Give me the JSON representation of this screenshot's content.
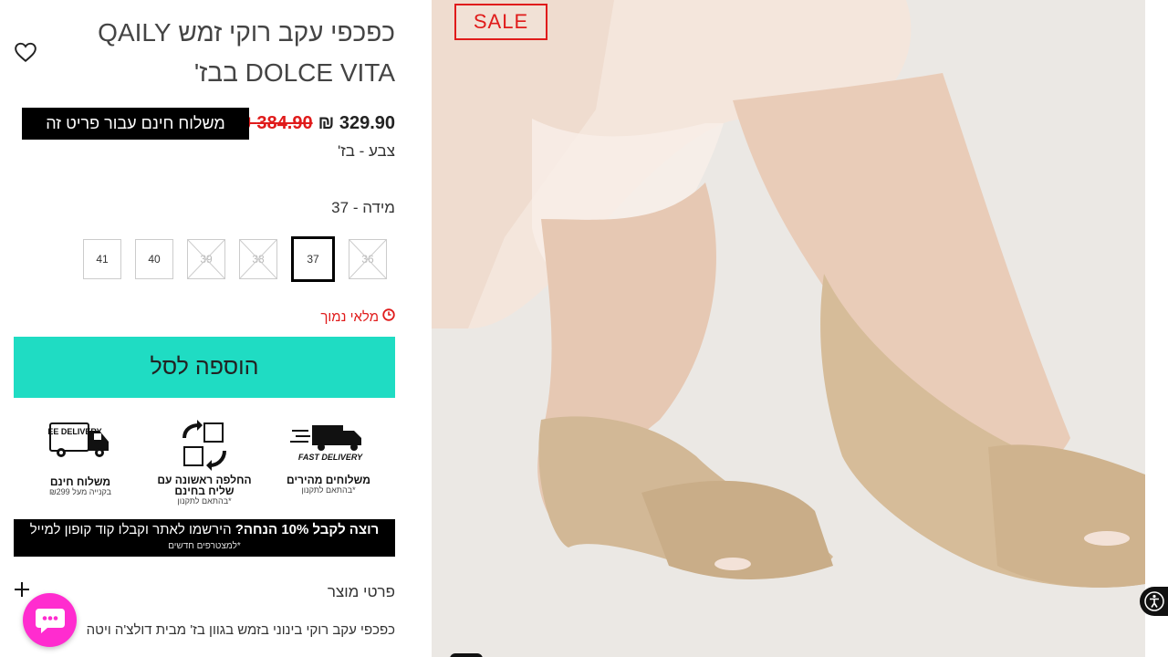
{
  "product": {
    "title": "כפכפי עקב רוקי זמש QAILY DOLCE VITA בבז'",
    "price_now": "329.90 ₪",
    "price_old": "384.90 ₪",
    "free_shipping_banner": "משלוח חינם עבור פריט זה",
    "color_label": "צבע - בז'",
    "size_label": "מידה - 37",
    "sale_badge": "SALE",
    "stock_status": "מלאי נמוך",
    "add_to_cart": "הוספה לסל"
  },
  "sizes": [
    {
      "label": "36",
      "available": false,
      "selected": false
    },
    {
      "label": "37",
      "available": true,
      "selected": true
    },
    {
      "label": "38",
      "available": false,
      "selected": false
    },
    {
      "label": "39",
      "available": false,
      "selected": false
    },
    {
      "label": "40",
      "available": true,
      "selected": false
    },
    {
      "label": "41",
      "available": true,
      "selected": false
    }
  ],
  "perks": [
    {
      "icon": "fast-delivery-truck-icon",
      "badge": "FAST DELIVERY",
      "title": "משלוחים מהירים",
      "sub": "*בהתאם לתקנון"
    },
    {
      "icon": "exchange-boxes-icon",
      "title": "החלפה ראשונה עם שליח בחינם",
      "sub": "*בהתאם לתקנון"
    },
    {
      "icon": "free-delivery-truck-icon",
      "badge": "FREE DELIVERY",
      "title": "משלוח חינם",
      "sub": "בקנייה מעל ₪299"
    }
  ],
  "promo": {
    "bold": "רוצה לקבל 10% הנחה?",
    "text": "הירשמו לאתר וקבלו קוד קופון למייל",
    "sub": "*למצטרפים חדשים"
  },
  "details": {
    "title": "פרטי מוצר",
    "text": "כפכפי עקב רוקי בינוני בזמש בגוון בז' מבית דולצ'ה ויטה"
  },
  "colors": {
    "accent": "#1fdcc3",
    "sale": "#e01b1b",
    "chat": "#ff2ccf"
  }
}
